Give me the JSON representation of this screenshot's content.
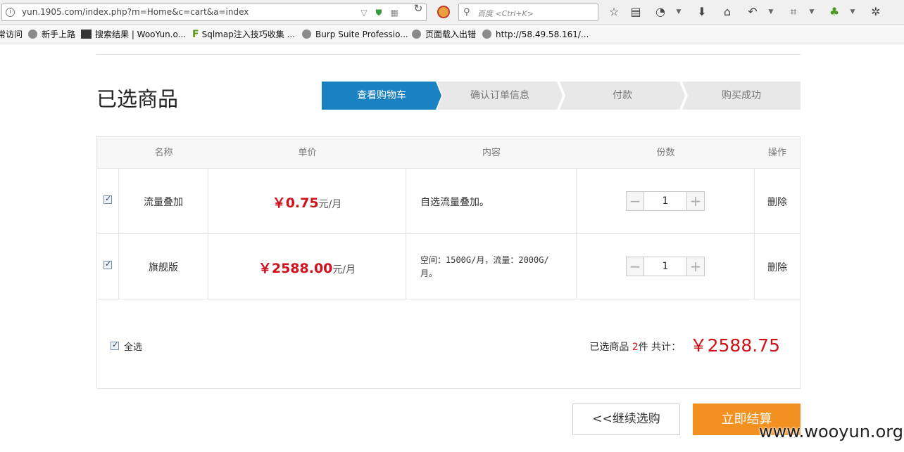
{
  "browser": {
    "url": "yun.1905.com/index.php?m=Home&c=cart&a=index",
    "search_placeholder": "百度 <Ctrl+K>",
    "bookmarks": [
      "常访问",
      "新手上路",
      "搜索结果 | WooYun.o...",
      "Sqlmap注入技巧收集 ...",
      "Burp Suite Professio...",
      "页面载入出错",
      "http://58.49.58.161/..."
    ]
  },
  "page": {
    "title": "已选商品",
    "steps": [
      "查看购物车",
      "确认订单信息",
      "付款",
      "购买成功"
    ],
    "active_step": 0
  },
  "cart": {
    "headers": [
      "名称",
      "单价",
      "内容",
      "份数",
      "操作"
    ],
    "items": [
      {
        "name": "流量叠加",
        "price": "￥0.75",
        "unit": "元/月",
        "content": "自选流量叠加。",
        "quantity": "1",
        "action": "删除",
        "checked": true
      },
      {
        "name": "旗舰版",
        "price": "￥2588.00",
        "unit": "元/月",
        "content": "空间：1500G/月，流量：2000G/月。",
        "quantity": "1",
        "action": "删除",
        "checked": true
      }
    ],
    "select_all_label": "全选",
    "summary": {
      "prefix": "已选商品",
      "count": "2",
      "count_unit": "件",
      "total_label": "共计：",
      "total": "￥2588.75"
    }
  },
  "actions": {
    "continue_label": "<<继续选购",
    "checkout_label": "立即结算"
  },
  "watermark": "www.wooyun.org",
  "colors": {
    "accent_blue": "#1a82c3",
    "price_red": "#d0111b",
    "checkout_orange": "#f29120"
  }
}
